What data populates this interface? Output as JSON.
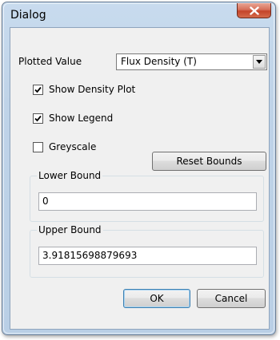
{
  "window": {
    "title": "Dialog"
  },
  "plotted_value": {
    "label": "Plotted Value",
    "selected": "Flux Density (T)"
  },
  "checkboxes": [
    {
      "label": "Show Density Plot",
      "checked": true
    },
    {
      "label": "Show Legend",
      "checked": true
    },
    {
      "label": "Greyscale",
      "checked": false
    }
  ],
  "buttons": {
    "reset_bounds": "Reset Bounds",
    "ok": "OK",
    "cancel": "Cancel"
  },
  "lower_bound": {
    "label": "Lower Bound",
    "value": "0"
  },
  "upper_bound": {
    "label": "Upper Bound",
    "value": "3.91815698879693"
  },
  "icons": {
    "close": "close-icon",
    "dropdown": "chevron-down-icon",
    "check": "checkmark-icon"
  }
}
